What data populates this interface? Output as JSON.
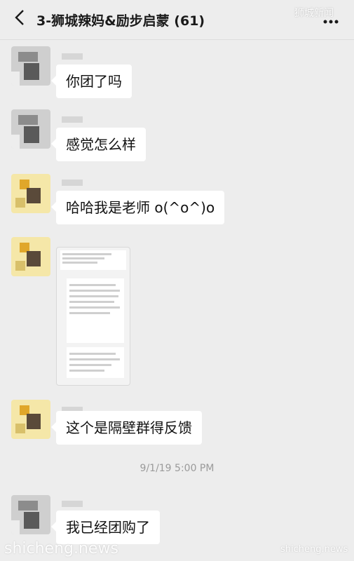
{
  "header": {
    "title": "3-狮城辣妈&励步启蒙 (61)",
    "watermark": "狮城新闻"
  },
  "messages": [
    {
      "text": "你团了吗"
    },
    {
      "text": "感觉怎么样"
    },
    {
      "text": "哈哈我是老师 o(^o^)o"
    },
    {
      "text": "这个是隔壁群得反馈"
    },
    {
      "text": "我已经团购了"
    }
  ],
  "timestamp": "9/1/19 5:00 PM",
  "watermarks": {
    "bottom_left": "shicheng.news",
    "bottom_right": "shicheng.news"
  },
  "icons": {
    "back": "chevron-left-icon",
    "more": "more-dots-icon"
  }
}
